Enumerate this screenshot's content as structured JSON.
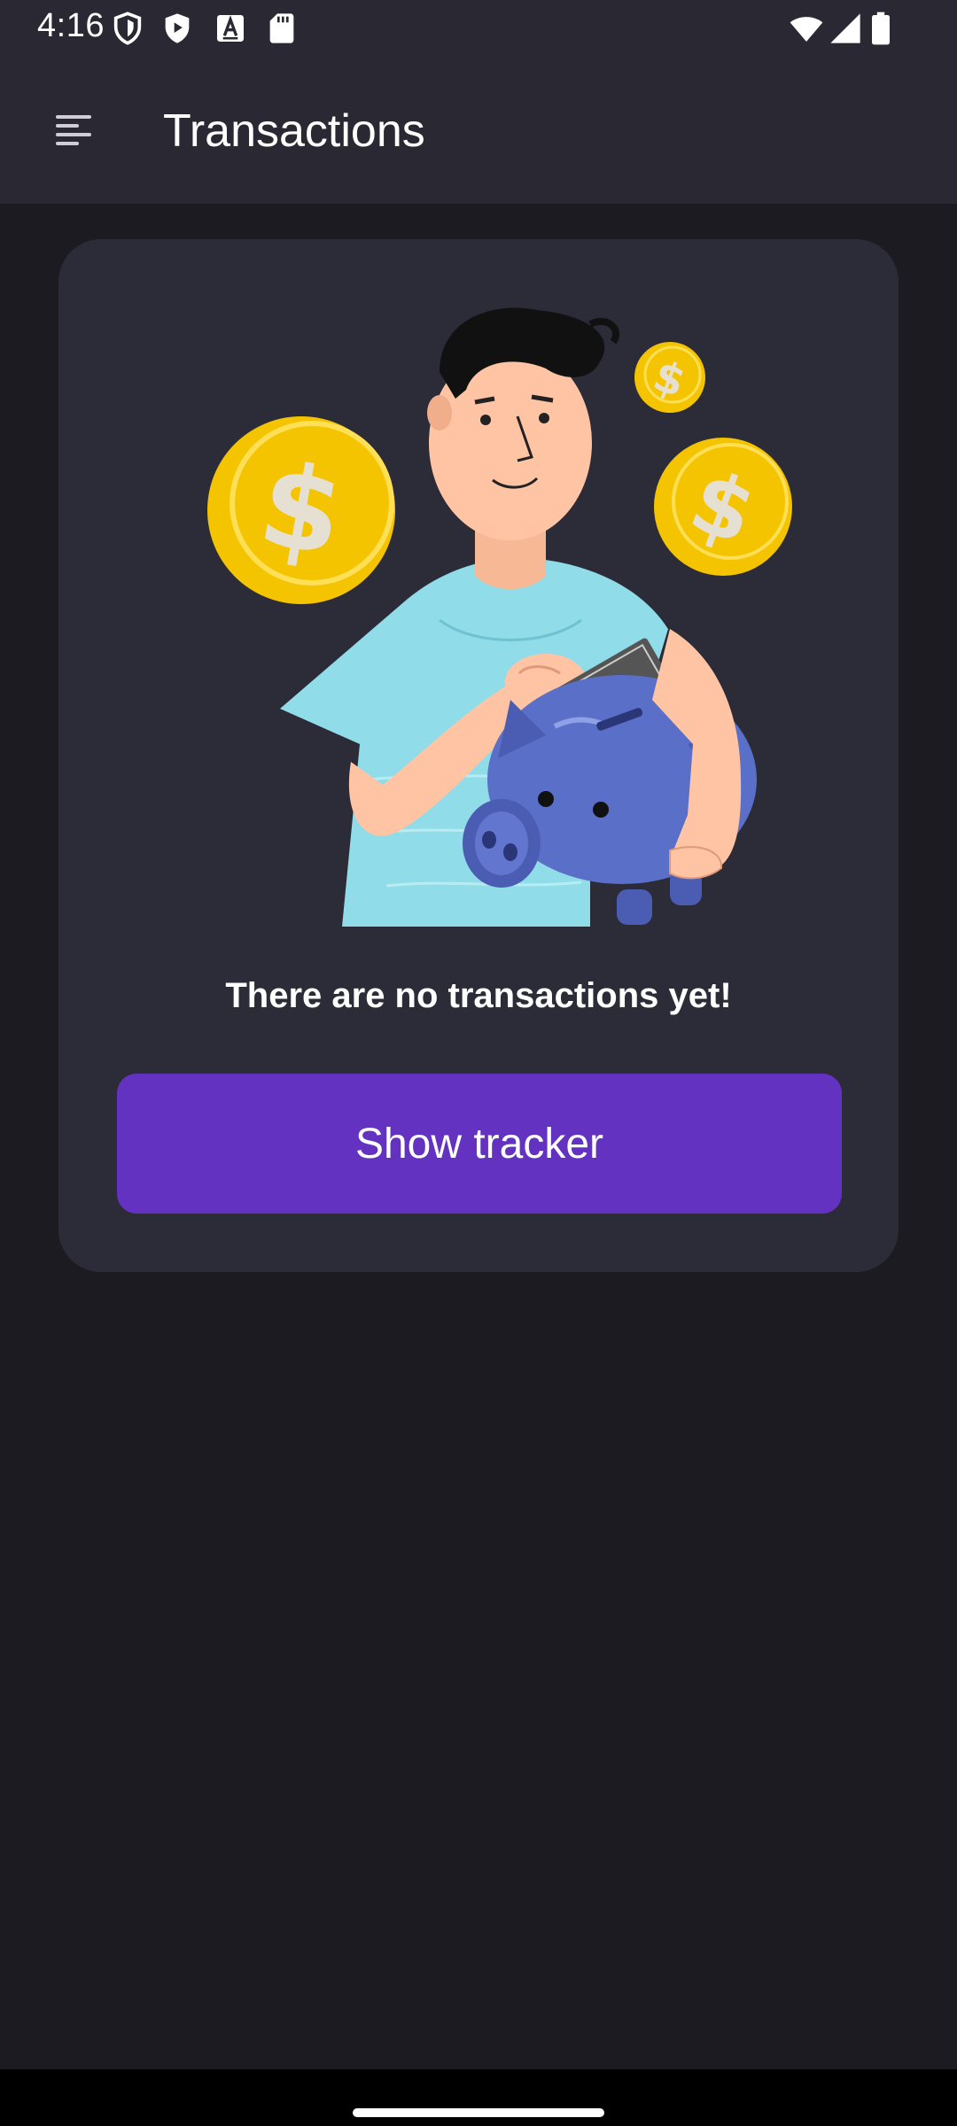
{
  "status_bar": {
    "time": "4:16",
    "left_icons": [
      "shield-icon",
      "play-protect-icon",
      "text-a-icon",
      "sd-card-icon"
    ],
    "right_icons": [
      "wifi-icon",
      "cellular-signal-icon",
      "battery-icon"
    ]
  },
  "app_bar": {
    "menu_icon": "menu-icon",
    "title": "Transactions"
  },
  "empty_state": {
    "illustration": "man-with-piggy-bank-and-coins",
    "message": "There are no transactions yet!",
    "button_label": "Show tracker"
  },
  "colors": {
    "background": "#1c1b21",
    "bar": "#2a2933",
    "card": "#2c2b38",
    "accent": "#6432c0"
  }
}
